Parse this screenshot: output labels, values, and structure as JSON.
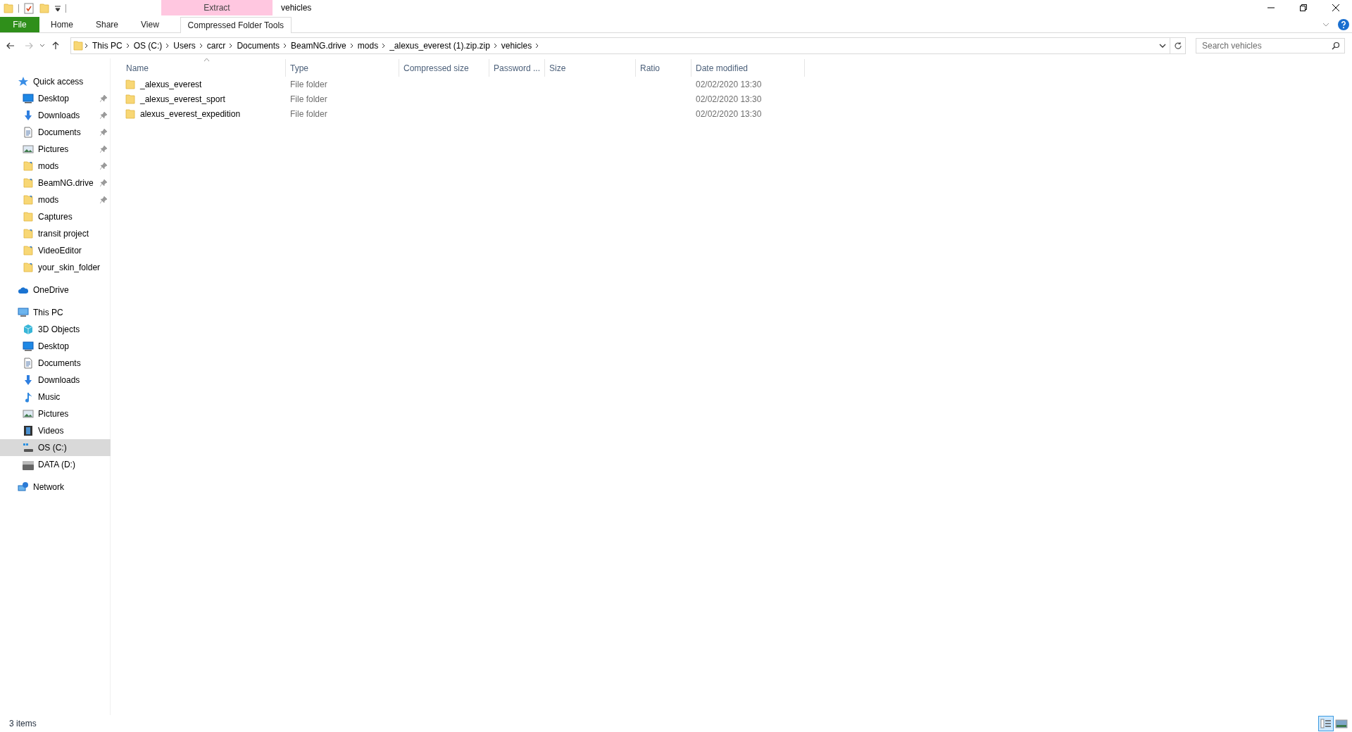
{
  "title_bar": {
    "context_tab": "Extract",
    "title": "vehicles"
  },
  "ribbon_tabs": [
    {
      "label": "File",
      "kind": "file"
    },
    {
      "label": "Home",
      "kind": "tab"
    },
    {
      "label": "Share",
      "kind": "tab"
    },
    {
      "label": "View",
      "kind": "tab"
    },
    {
      "label": "Compressed Folder Tools",
      "kind": "context"
    }
  ],
  "address_bar": {
    "crumbs": [
      "This PC",
      "OS (C:)",
      "Users",
      "carcr",
      "Documents",
      "BeamNG.drive",
      "mods",
      "_alexus_everest (1).zip.zip",
      "vehicles"
    ]
  },
  "search": {
    "placeholder": "Search vehicles"
  },
  "navigation": [
    {
      "label": "Quick access",
      "kind": "star",
      "selected": false,
      "children": [
        {
          "label": "Desktop",
          "kind": "desktop",
          "pinned": true,
          "selected": false
        },
        {
          "label": "Downloads",
          "kind": "download",
          "pinned": true,
          "selected": false
        },
        {
          "label": "Documents",
          "kind": "document",
          "pinned": true,
          "selected": false
        },
        {
          "label": "Pictures",
          "kind": "pictures",
          "pinned": true,
          "selected": false
        },
        {
          "label": "mods",
          "kind": "shortcut",
          "pinned": true,
          "selected": false
        },
        {
          "label": "BeamNG.drive",
          "kind": "shortcut",
          "pinned": true,
          "selected": false
        },
        {
          "label": "mods",
          "kind": "shortcut",
          "pinned": true,
          "selected": false
        },
        {
          "label": "Captures",
          "kind": "folder",
          "pinned": false,
          "selected": false
        },
        {
          "label": "transit project",
          "kind": "shortcut",
          "pinned": false,
          "selected": false
        },
        {
          "label": "VideoEditor",
          "kind": "shortcut",
          "pinned": false,
          "selected": false
        },
        {
          "label": "your_skin_folder",
          "kind": "shortcut",
          "pinned": false,
          "selected": false
        }
      ]
    },
    {
      "label": "OneDrive",
      "kind": "cloud",
      "selected": false
    },
    {
      "label": "This PC",
      "kind": "pc",
      "selected": false,
      "children": [
        {
          "label": "3D Objects",
          "kind": "cube",
          "pinned": false,
          "selected": false
        },
        {
          "label": "Desktop",
          "kind": "desktop",
          "pinned": false,
          "selected": false
        },
        {
          "label": "Documents",
          "kind": "document",
          "pinned": false,
          "selected": false
        },
        {
          "label": "Downloads",
          "kind": "download",
          "pinned": false,
          "selected": false
        },
        {
          "label": "Music",
          "kind": "music",
          "pinned": false,
          "selected": false
        },
        {
          "label": "Pictures",
          "kind": "pictures",
          "pinned": false,
          "selected": false
        },
        {
          "label": "Videos",
          "kind": "video",
          "pinned": false,
          "selected": false
        },
        {
          "label": "OS (C:)",
          "kind": "osdrive",
          "pinned": false,
          "selected": true
        },
        {
          "label": "DATA (D:)",
          "kind": "drive",
          "pinned": false,
          "selected": false
        }
      ]
    },
    {
      "label": "Network",
      "kind": "network",
      "selected": false
    }
  ],
  "columns": [
    {
      "label": "Name",
      "sorted": true
    },
    {
      "label": "Type",
      "sorted": false
    },
    {
      "label": "Compressed size",
      "sorted": false
    },
    {
      "label": "Password ...",
      "sorted": false
    },
    {
      "label": "Size",
      "sorted": false
    },
    {
      "label": "Ratio",
      "sorted": false
    },
    {
      "label": "Date modified",
      "sorted": false
    }
  ],
  "rows": [
    {
      "name": "_alexus_everest",
      "type": "File folder",
      "date_modified": "02/02/2020 13:30"
    },
    {
      "name": "_alexus_everest_sport",
      "type": "File folder",
      "date_modified": "02/02/2020 13:30"
    },
    {
      "name": "alexus_everest_expedition",
      "type": "File folder",
      "date_modified": "02/02/2020 13:30"
    }
  ],
  "status_bar": {
    "item_count": "3 items",
    "views": [
      {
        "kind": "details",
        "selected": true
      },
      {
        "kind": "thumbnails",
        "selected": false
      }
    ]
  }
}
